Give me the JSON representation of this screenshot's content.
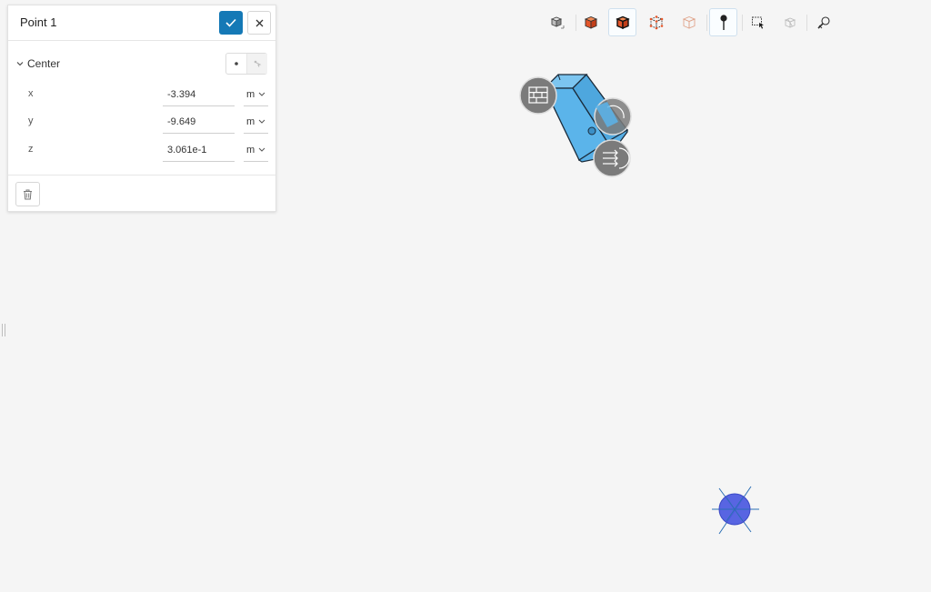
{
  "panel": {
    "title": "Point 1",
    "section": {
      "label": "Center"
    },
    "coordinates": [
      {
        "axis": "x",
        "value": "-3.394",
        "unit": "m"
      },
      {
        "axis": "y",
        "value": "-9.649",
        "unit": "m"
      },
      {
        "axis": "z",
        "value": "3.061e-1",
        "unit": "m"
      }
    ]
  },
  "toolbar": {
    "buttons": [
      {
        "icon": "view-cube-icon",
        "active": false
      },
      {
        "icon": "solid-box-icon",
        "active": false
      },
      {
        "icon": "solid-edges-box-icon",
        "active": true
      },
      {
        "icon": "vertex-box-icon",
        "active": false
      },
      {
        "icon": "transparent-box-icon",
        "active": false
      },
      {
        "icon": "point-pin-icon",
        "active": true
      },
      {
        "icon": "box-select-icon",
        "active": false
      },
      {
        "icon": "hidden-box-icon",
        "active": false
      },
      {
        "icon": "search-tool-icon",
        "active": false
      }
    ]
  },
  "colors": {
    "accent": "#1579b6",
    "geometry_fill": "#5bb4ea",
    "geometry_edge": "#1b2b3a",
    "marker_fill": "#4a58e0",
    "marker_line": "#2c6fb5",
    "badge_fill": "#7b7b7b",
    "background": "#f5f5f5"
  }
}
